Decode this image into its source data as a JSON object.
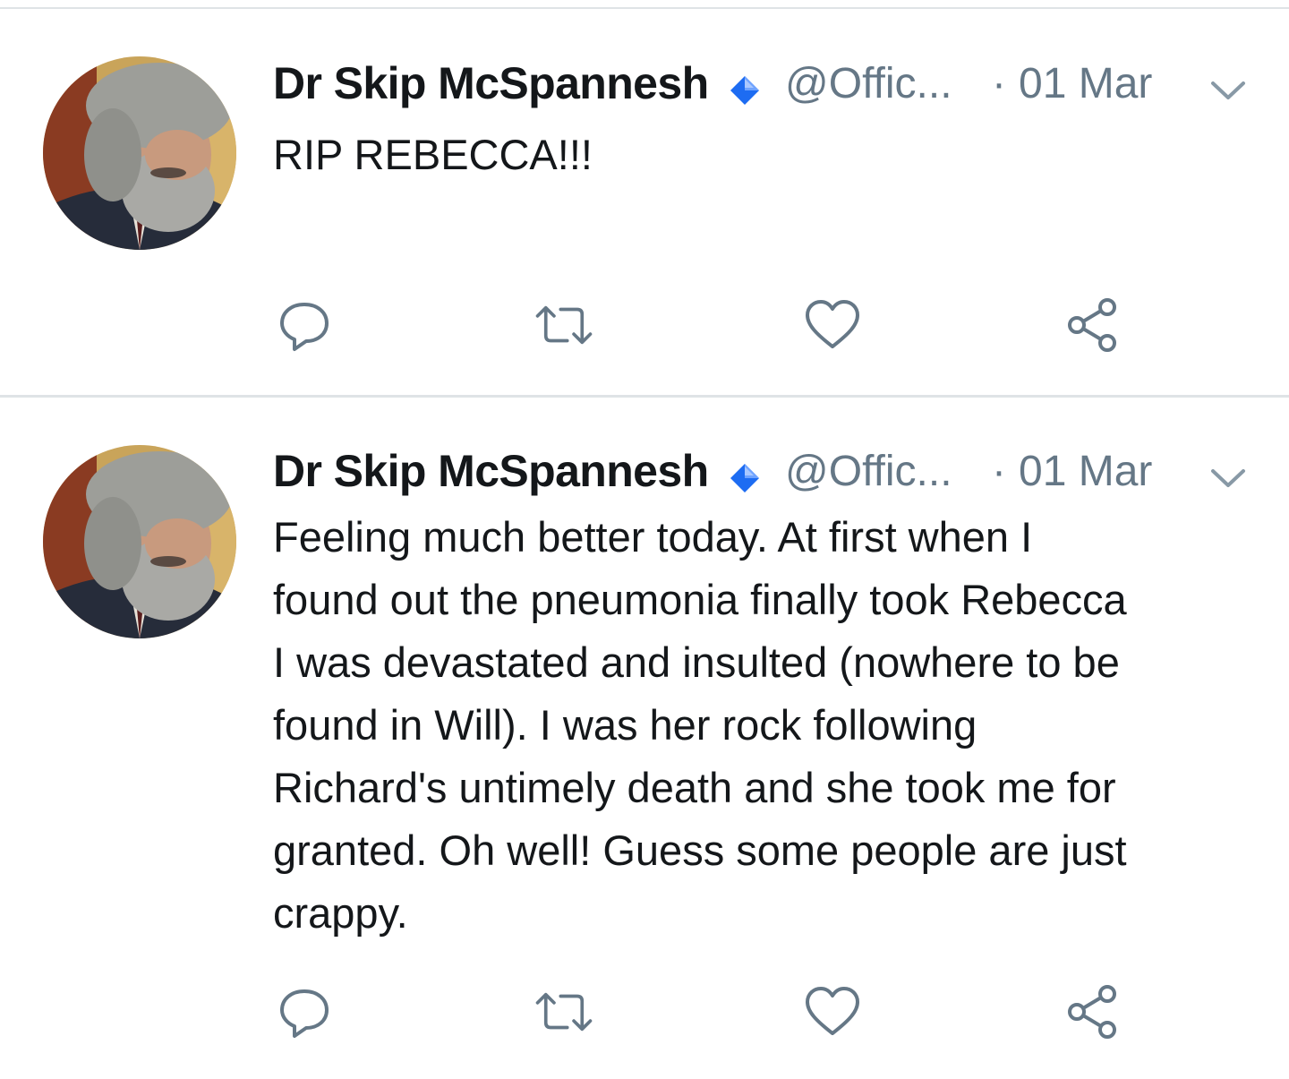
{
  "colors": {
    "text_primary": "#14171a",
    "text_secondary": "#657786",
    "icon": "#657786",
    "verified": "#1d6cf2",
    "divider": "#dfe3e6",
    "background": "#ffffff"
  },
  "tweets": [
    {
      "display_name": "Dr Skip McSpannesh",
      "verified_icon": "blue-diamond-icon",
      "handle": "@Offic...",
      "separator": "·",
      "timestamp": "01 Mar",
      "text": "RIP REBECCA!!!",
      "actions": [
        "reply-icon",
        "retweet-icon",
        "like-icon",
        "share-icon"
      ]
    },
    {
      "display_name": "Dr Skip McSpannesh",
      "verified_icon": "blue-diamond-icon",
      "handle": "@Offic...",
      "separator": "·",
      "timestamp": "01 Mar",
      "text": "Feeling much better today. At first when I\nfound out the pneumonia finally took Rebecca\nI was devastated and insulted (nowhere to be\nfound in Will). I was her rock following\nRichard's untimely death and she took me for\ngranted. Oh well! Guess some people are just\ncrappy.",
      "actions": [
        "reply-icon",
        "retweet-icon",
        "like-icon",
        "share-icon"
      ]
    }
  ]
}
